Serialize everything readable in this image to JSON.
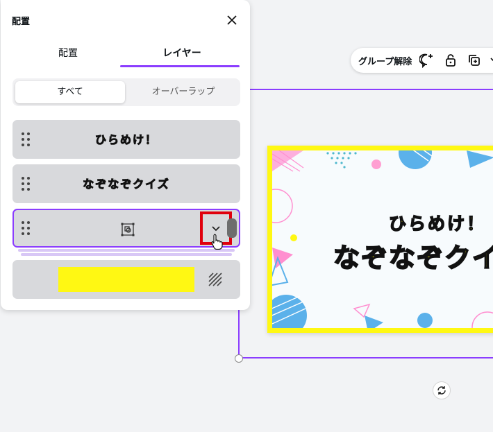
{
  "panel": {
    "title": "配置",
    "tabs": [
      {
        "label": "配置",
        "active": false
      },
      {
        "label": "レイヤー",
        "active": true
      }
    ],
    "filter": {
      "options": [
        "すべて",
        "オーバーラップ"
      ],
      "selected": "すべて"
    },
    "layers": [
      {
        "type": "text",
        "text": "ひらめけ！"
      },
      {
        "type": "text",
        "text": "なぞなぞクイズ"
      },
      {
        "type": "group",
        "icon": "group-icon",
        "selected": true,
        "action_icon": "chevron-down-icon"
      },
      {
        "type": "background",
        "fill": "#fff813",
        "icon": "transparency-icon"
      }
    ]
  },
  "toolbar": {
    "ungroup_label": "グループ解除",
    "icons": [
      "comment-add-icon",
      "lock-icon",
      "duplicate-icon"
    ]
  },
  "design": {
    "line1": "ひらめけ！",
    "line2": "なぞなぞクイ"
  },
  "colors": {
    "accent": "#8b3dff",
    "highlight": "#e0000d",
    "design_yellow": "#fff813",
    "layer_bg": "#d8d9dc"
  }
}
